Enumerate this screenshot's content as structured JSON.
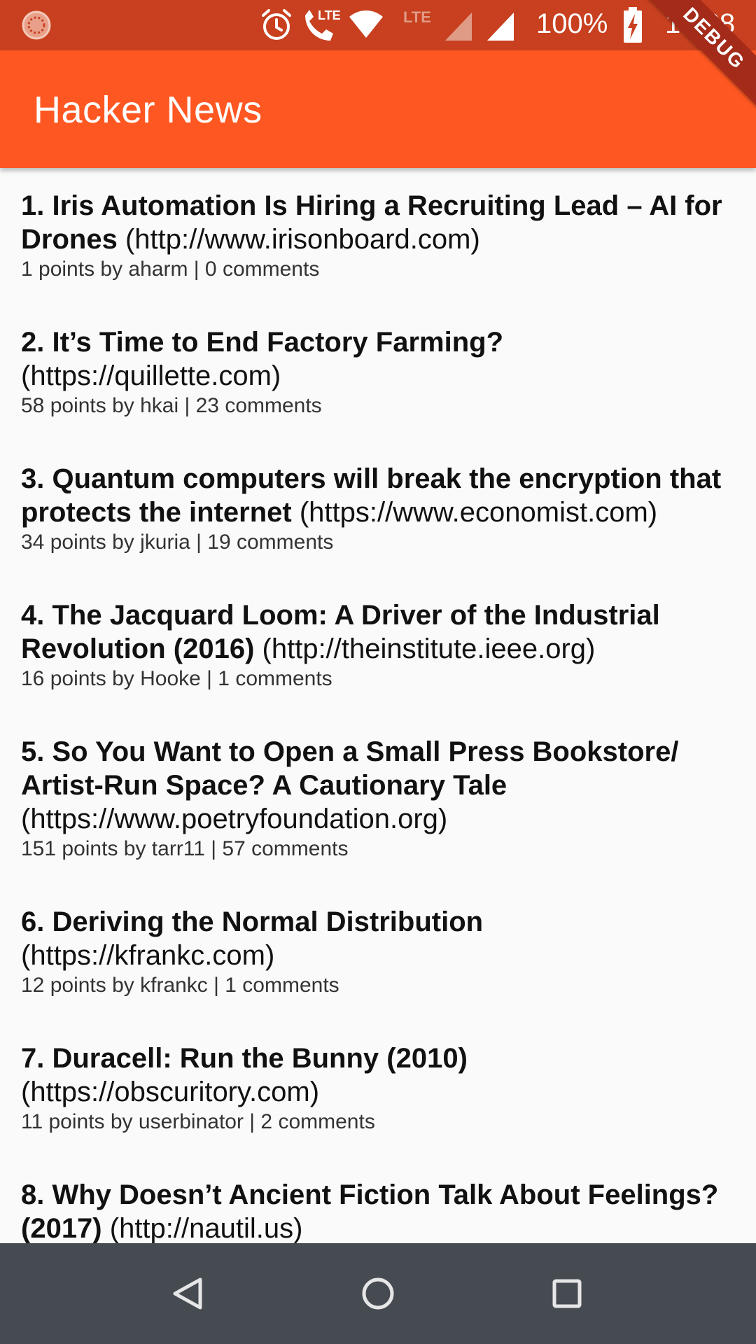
{
  "status_bar": {
    "battery_percent": "100%",
    "time": "16:38",
    "icons": [
      "app-notification-icon",
      "alarm-icon",
      "volte-call-icon",
      "wifi-icon",
      "lte-signal-icon",
      "cell-signal-icon",
      "battery-charging-icon"
    ],
    "lte_label": "LTE"
  },
  "app_bar": {
    "title": "Hacker News",
    "background_color": "#ff5722"
  },
  "debug_banner": "DEBUG",
  "stories": [
    {
      "rank_title": "1. Iris Automation Is Hiring a Recruiting Lead – AI for Drones",
      "url": "(http://www.irisonboard.com)",
      "meta": "1 points by aharm | 0 comments"
    },
    {
      "rank_title": "2. It’s Time to End Factory Farming?",
      "url": "(https://quillette.com)",
      "meta": "58 points by hkai | 23 comments"
    },
    {
      "rank_title": "3. Quantum computers will break the encryption that protects the internet",
      "url": "(https://www.economist.com)",
      "meta": "34 points by jkuria | 19 comments"
    },
    {
      "rank_title": "4. The Jacquard Loom: A Driver of the Industrial Revolution (2016)",
      "url": "(http://theinstitute.ieee.org)",
      "meta": "16 points by Hooke | 1 comments"
    },
    {
      "rank_title": "5. So You Want to Open a Small Press Bookstore/ Artist-Run Space? A Cautionary Tale",
      "url": "(https://www.poetryfoundation.org)",
      "meta": "151 points by tarr11 | 57 comments"
    },
    {
      "rank_title": "6. Deriving the Normal Distribution",
      "url": "(https://kfrankc.com)",
      "meta": "12 points by kfrankc | 1 comments"
    },
    {
      "rank_title": "7. Duracell: Run the Bunny (2010)",
      "url": "(https://obscuritory.com)",
      "meta": "11 points by userbinator | 2 comments"
    },
    {
      "rank_title": "8. Why Doesn’t Ancient Fiction Talk About Feelings? (2017)",
      "url": "(http://nautil.us)",
      "meta": ""
    }
  ],
  "nav_bar": {
    "buttons": [
      "back-icon",
      "home-icon",
      "recents-icon"
    ]
  }
}
